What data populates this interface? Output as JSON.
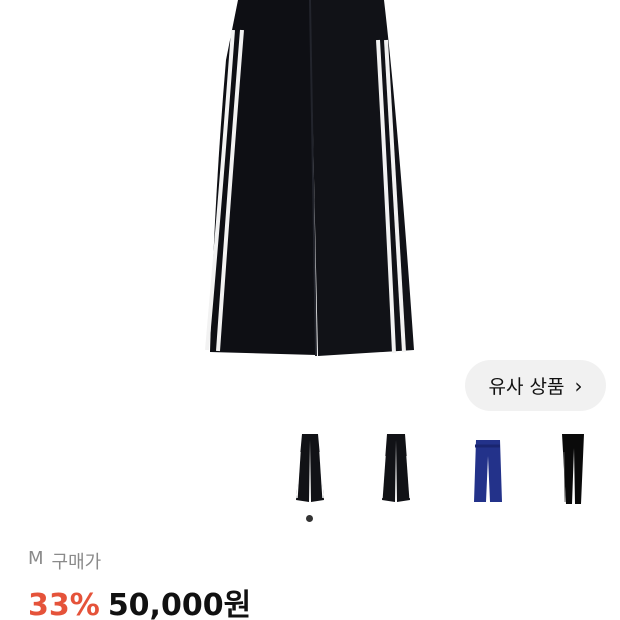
{
  "product": {
    "colors": {
      "pants": "#0e0f14",
      "stripe": "#ffffff",
      "accent_discount": "#e5533a"
    }
  },
  "similar_button": {
    "label": "유사 상품",
    "icon": "chevron-right-icon",
    "icon_glyph": "›"
  },
  "thumbnails": [
    {
      "color": "#111216",
      "style": "wide-leg-stripes"
    },
    {
      "color": "#111216",
      "style": "wide-leg-stripes"
    },
    {
      "color": "#23328a",
      "style": "track-pants-blue"
    },
    {
      "color": "#0a0a0a",
      "style": "slim-leggings"
    }
  ],
  "carousel": {
    "active_index": 0
  },
  "pricing": {
    "size": "M",
    "label": "구매가",
    "discount": "33%",
    "price": "50,000원"
  }
}
